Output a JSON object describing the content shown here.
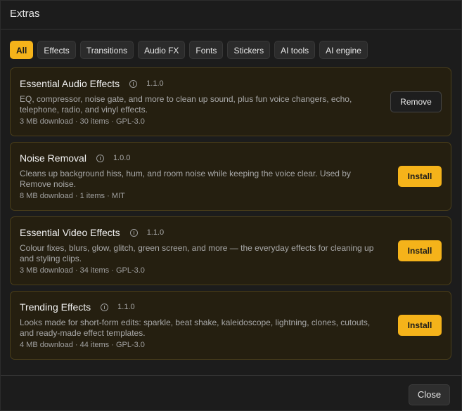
{
  "dialog": {
    "title": "Extras"
  },
  "filters": [
    {
      "label": "All",
      "active": true
    },
    {
      "label": "Effects",
      "active": false
    },
    {
      "label": "Transitions",
      "active": false
    },
    {
      "label": "Audio FX",
      "active": false
    },
    {
      "label": "Fonts",
      "active": false
    },
    {
      "label": "Stickers",
      "active": false
    },
    {
      "label": "AI tools",
      "active": false
    },
    {
      "label": "AI engine",
      "active": false
    }
  ],
  "extras": [
    {
      "name": "Essential Audio Effects",
      "version": "1.1.0",
      "description": "EQ, compressor, noise gate, and more to clean up sound, plus fun voice changers, echo, telephone, radio, and vinyl effects.",
      "meta": "3 MB download · 30 items · GPL-3.0",
      "action": "Remove"
    },
    {
      "name": "Noise Removal",
      "version": "1.0.0",
      "description": "Cleans up background hiss, hum, and room noise while keeping the voice clear. Used by Remove noise.",
      "meta": "8 MB download · 1 items · MIT",
      "action": "Install"
    },
    {
      "name": "Essential Video Effects",
      "version": "1.1.0",
      "description": "Colour fixes, blurs, glow, glitch, green screen, and more — the everyday effects for cleaning up and styling clips.",
      "meta": "3 MB download · 34 items · GPL-3.0",
      "action": "Install"
    },
    {
      "name": "Trending Effects",
      "version": "1.1.0",
      "description": "Looks made for short-form edits: sparkle, beat shake, kaleidoscope, lightning, clones, cutouts, and ready-made effect templates.",
      "meta": "4 MB download · 44 items · GPL-3.0",
      "action": "Install"
    }
  ],
  "footer": {
    "close_label": "Close"
  },
  "colors": {
    "accent": "#f5b31a",
    "card_bg": "#251f10",
    "card_border": "#4a3e1a"
  }
}
